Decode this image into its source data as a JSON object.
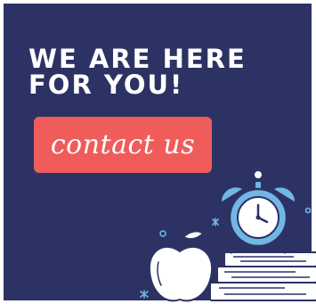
{
  "banner": {
    "headline": "WE ARE HERE\nFOR YOU!",
    "contact_label": "contact us"
  },
  "colors": {
    "background": "#2d3264",
    "button": "#f05c5a",
    "text": "#ffffff",
    "clock_face": "#72b6e4",
    "line": "#2d3264"
  },
  "icons": [
    "apple-icon",
    "books-icon",
    "alarm-clock-icon",
    "sparkle-icon"
  ]
}
